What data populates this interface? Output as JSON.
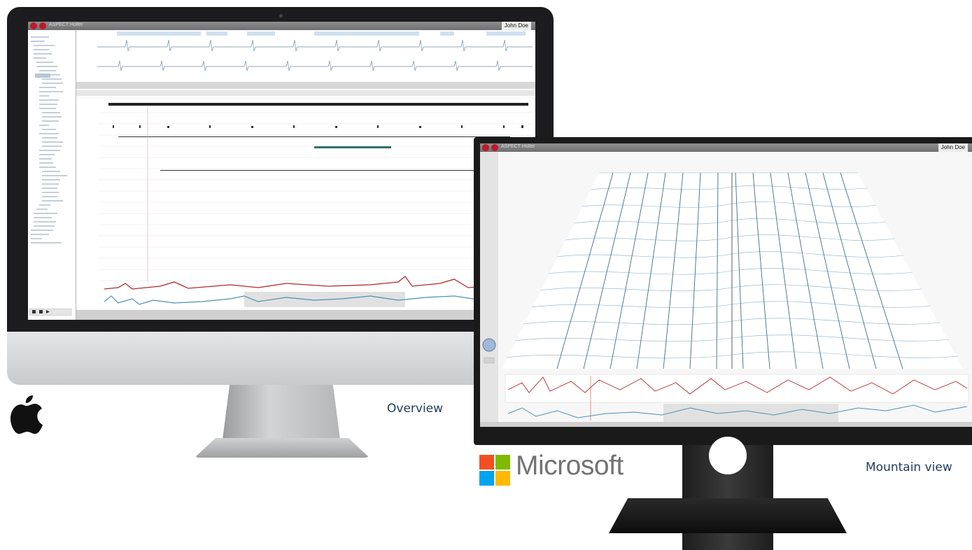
{
  "imac": {
    "app_title": "ASPECT Holter",
    "user_menu": "John Doe",
    "view_caption": "Overview"
  },
  "dell": {
    "app_title": "ASPECT Holter",
    "user_menu": "John Doe",
    "view_caption": "Mountain view"
  },
  "brands": {
    "apple": {
      "icon": "apple-logo-icon"
    },
    "microsoft": {
      "wordmark": "Microsoft",
      "icon": "windows-logo-icon",
      "colors": [
        "#f25022",
        "#7fba00",
        "#00a4ef",
        "#ffb900"
      ]
    }
  },
  "colors": {
    "app_red": "#c0182a",
    "ecg_trace": "#4a90b8",
    "heart_rate_trace": "#b42a2a",
    "caption_text": "#1f3b5c"
  }
}
